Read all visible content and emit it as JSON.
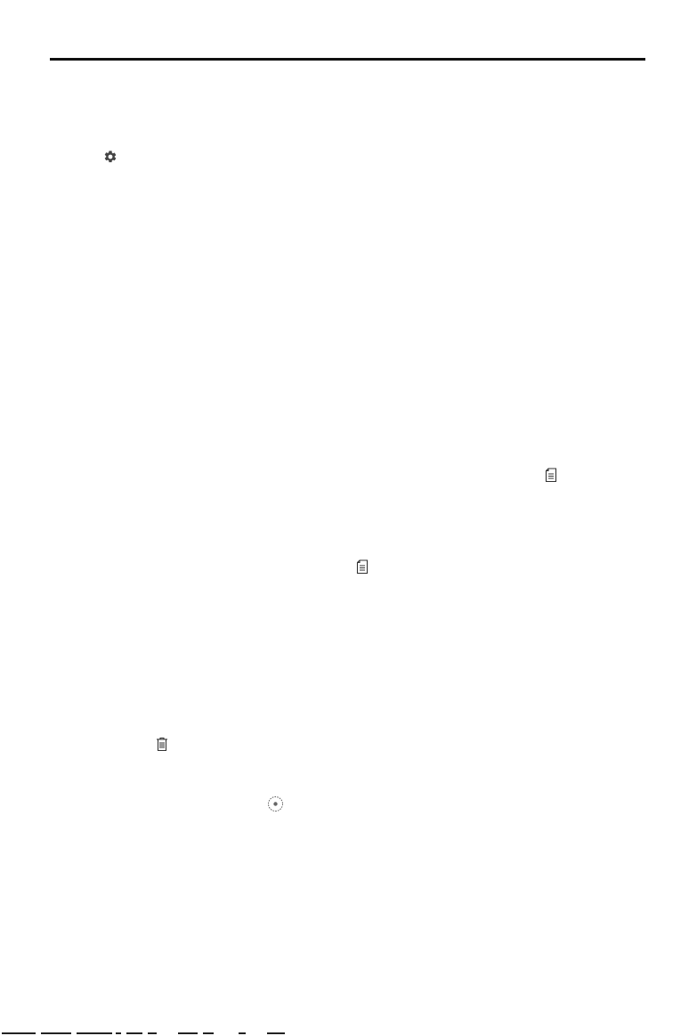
{
  "icons": {
    "settings": "gear-icon",
    "document_1": "document-icon",
    "document_2": "document-icon",
    "delete": "trash-icon",
    "target": "target-icon"
  },
  "colors": {
    "rule": "#111111",
    "icon": "#333333",
    "background": "#ffffff"
  }
}
